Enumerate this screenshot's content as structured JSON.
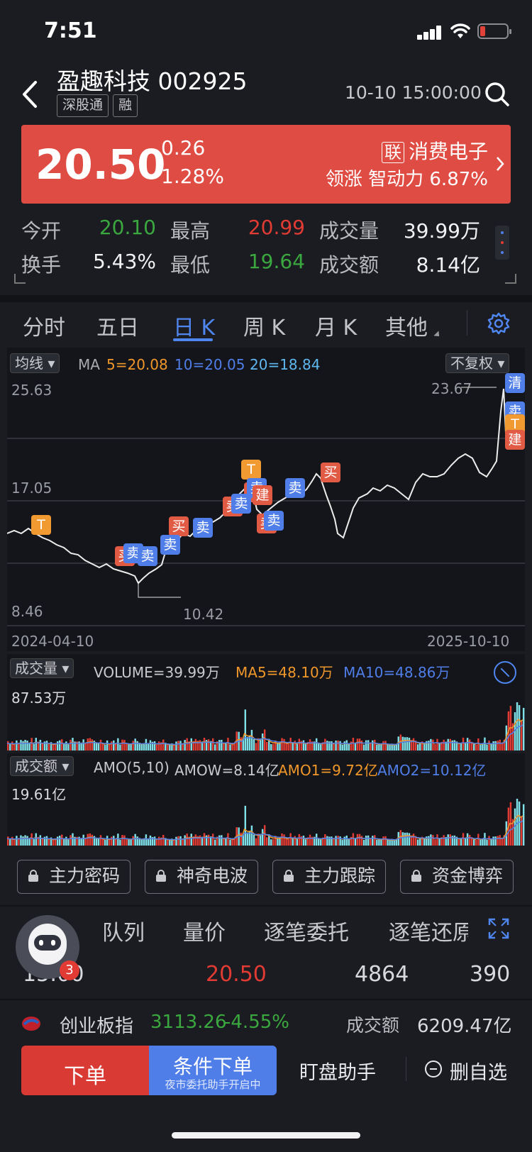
{
  "status_bar": {
    "time": "7:51"
  },
  "header": {
    "title": "盈趣科技 002925",
    "tags": [
      "深股通",
      "融"
    ],
    "datetime": "10-10 15:00:00"
  },
  "price": {
    "last": "20.50",
    "change": "0.26",
    "change_pct": "1.28%",
    "sector_tag": "联",
    "sector": "消费电子",
    "lead_label": "领涨",
    "lead_name": "智动力",
    "lead_pct": "6.87%"
  },
  "quote": {
    "open_label": "今开",
    "open": "20.10",
    "high_label": "最高",
    "high": "20.99",
    "vol_label": "成交量",
    "vol": "39.99万",
    "turnover_label": "换手",
    "turnover": "5.43%",
    "low_label": "最低",
    "low": "19.64",
    "amount_label": "成交额",
    "amount": "8.14亿"
  },
  "tabs": [
    "分时",
    "五日",
    "日 K",
    "周 K",
    "月 K",
    "其他"
  ],
  "kline": {
    "ma_button": "均线",
    "ma_label": "MA",
    "ma5": "5=20.08",
    "ma10": "10=20.05",
    "ma20": "20=18.84",
    "adjust_button": "不复权",
    "y_top": "25.63",
    "y_mid": "17.05",
    "y_bot": "8.46",
    "max_label": "23.67",
    "min_label": "10.42",
    "date_start": "2024-04-10",
    "date_end": "2025-10-10",
    "signals": [
      "T",
      "买",
      "卖",
      "卖",
      "买",
      "卖",
      "卖",
      "卖",
      "买",
      "卖",
      "T",
      "卖",
      "建",
      "卖",
      "卖",
      "卖",
      "买",
      "清",
      "卖",
      "T",
      "建"
    ]
  },
  "volume": {
    "button": "成交量",
    "volume_label": "VOLUME=39.99万",
    "ma5_label": "MA5=48.10万",
    "ma10_label": "MA10=48.86万",
    "y_top": "87.53万"
  },
  "amount_chart": {
    "button": "成交额",
    "amo_label": "AMO(5,10)",
    "amow_label": "AMOW=8.14亿",
    "amo1_label": "AMO1=9.72亿",
    "amo2_label": "AMO2=10.12亿",
    "y_top": "19.61亿"
  },
  "tools": [
    "主力密码",
    "神奇电波",
    "主力跟踪",
    "资金博弈"
  ],
  "detail_tabs": [
    "队列",
    "量价",
    "逐笔委托",
    "逐笔还原"
  ],
  "trade_row": {
    "time": "15:00",
    "price": "20.50",
    "volume": "4864",
    "count": "390"
  },
  "avatar_badge": "3",
  "index_bar": {
    "name": "创业板指",
    "value": "3113.26",
    "pct": "-4.55%",
    "amount_label": "成交额",
    "amount": "6209.47亿"
  },
  "bottom_bar": {
    "order": "下单",
    "conditional": "条件下单",
    "conditional_sub": "夜市委托助手开启中",
    "assistant": "盯盘助手",
    "remove": "删自选"
  }
}
